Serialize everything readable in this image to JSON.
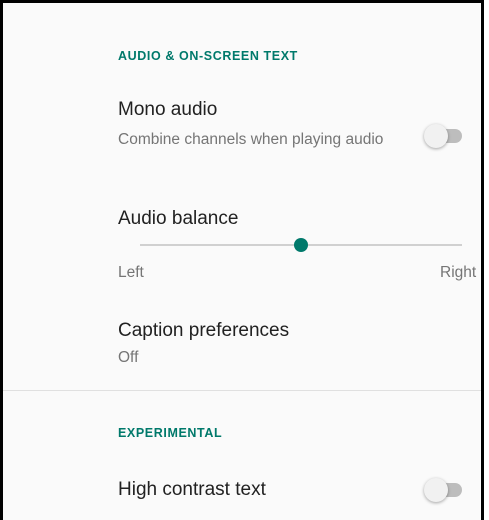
{
  "sections": {
    "audio": {
      "header": "AUDIO & ON-SCREEN TEXT",
      "mono_audio": {
        "title": "Mono audio",
        "summary": "Combine channels when playing audio",
        "enabled": false
      },
      "audio_balance": {
        "title": "Audio balance",
        "left_label": "Left",
        "right_label": "Right",
        "value": 0.5
      },
      "caption_preferences": {
        "title": "Caption preferences",
        "summary": "Off"
      }
    },
    "experimental": {
      "header": "EXPERIMENTAL",
      "high_contrast_text": {
        "title": "High contrast text",
        "enabled": false
      }
    }
  },
  "colors": {
    "accent": "#00796b",
    "background": "#fafafa",
    "switch_off_track": "#bdbdbd"
  }
}
